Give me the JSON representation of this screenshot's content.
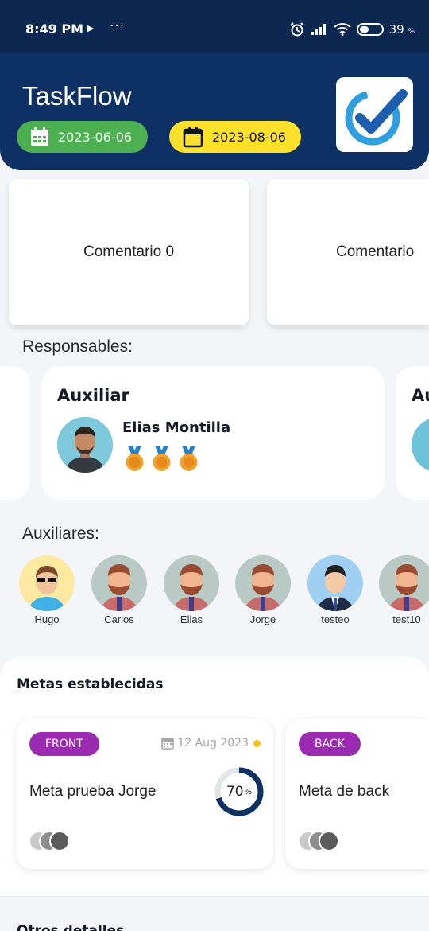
{
  "status_bar": {
    "time": "8:49 PM",
    "dots": "···",
    "battery_percent": "39",
    "battery_unit": "%"
  },
  "header": {
    "title": "TaskFlow",
    "start_date": "2023-06-06",
    "end_date": "2023-08-06",
    "colors": {
      "background": "#0e3165",
      "start_chip": "#4caf50",
      "end_chip": "#fde02a"
    }
  },
  "comments": [
    {
      "label": "Comentario 0"
    },
    {
      "label": "Comentario"
    }
  ],
  "responsables": {
    "label": "Responsables:",
    "cards": [
      {
        "role": "Auxiliar",
        "name": "Elias Montilla",
        "medals": 3
      },
      {
        "role": "Au"
      }
    ]
  },
  "auxiliares": {
    "label": "Auxiliares:",
    "people": [
      {
        "name": "Hugo"
      },
      {
        "name": "Carlos"
      },
      {
        "name": "Elias"
      },
      {
        "name": "Jorge"
      },
      {
        "name": "testeo"
      },
      {
        "name": "test10"
      }
    ]
  },
  "metas": {
    "title": "Metas establecidas",
    "cards": [
      {
        "tag": "FRONT",
        "date": "12 Aug 2023",
        "title": "Meta prueba Jorge",
        "progress": 70,
        "progress_unit": "%"
      },
      {
        "tag": "BACK",
        "title": "Meta de back"
      }
    ]
  },
  "otros": {
    "title": "Otros detalles"
  }
}
